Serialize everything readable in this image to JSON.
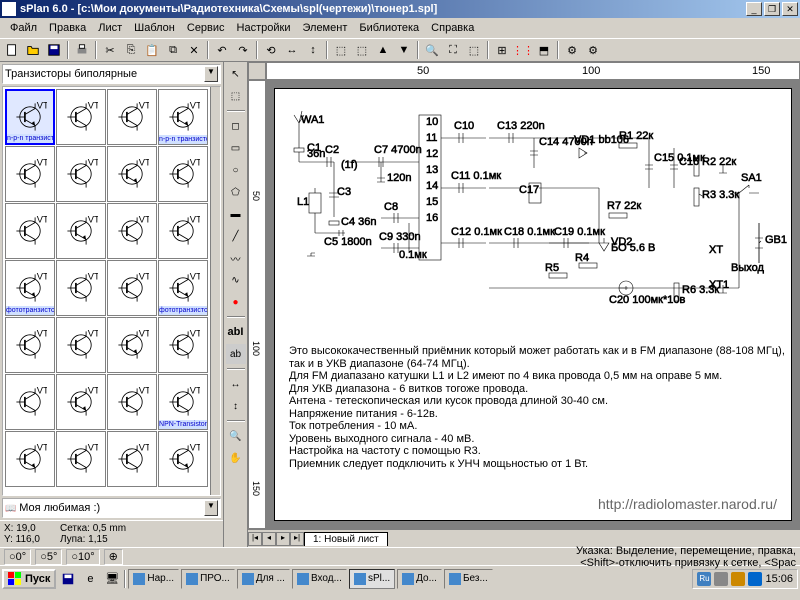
{
  "title": "sPlan 6.0 - [с:\\Мои документы\\Радиотехника\\Схемы\\spl(чертежи)\\тюнер1.spl]",
  "menu": [
    "Файл",
    "Правка",
    "Лист",
    "Шаблон",
    "Сервис",
    "Настройки",
    "Элемент",
    "Библиотека",
    "Справка"
  ],
  "leftCombo": "Транзисторы биполярные",
  "paletteLabels": [
    "n-p-n транзистор",
    "",
    "",
    "n-p-n транзистор",
    "",
    "",
    "",
    "",
    "",
    "",
    "",
    "",
    "фототранзистор",
    "",
    "",
    "фототранзистор",
    "",
    "",
    "",
    "",
    "",
    "",
    "",
    "NPN-Transistor"
  ],
  "bottomCombo": "Моя любимая :)",
  "statusLeft": {
    "x": "X: 19,0",
    "y": "Y: 116,0",
    "grid": "Сетка: 0,5 mm",
    "zoom": "Лупа: 1,15"
  },
  "rulerH": {
    "a": "50",
    "b": "100",
    "c": "150"
  },
  "rulerV": {
    "a": "50",
    "b": "100",
    "c": "150"
  },
  "sheetTab": "1: Новый лист",
  "schematic_labels": [
    "WA1",
    "C1",
    "36n",
    "L1",
    "C2",
    "C3",
    "C4",
    "36n",
    "C5",
    "1800n",
    "(1f)",
    "C7",
    "4700n",
    "120n",
    "C8",
    "C9",
    "330n",
    "0.1мк",
    "10",
    "11",
    "12",
    "13",
    "14",
    "15",
    "16",
    "C10",
    "C11",
    "0.1мк",
    "C12",
    "0.1мк",
    "C13",
    "C13 220n",
    "C14",
    "4700n",
    "C17",
    "0.1мк",
    "C18",
    "0.1мк",
    "C19",
    "0.1мк",
    "R4",
    "R5",
    "R7",
    "22к",
    "VD1",
    "bb106",
    "R1",
    "22к",
    "C15",
    "0.1мк",
    "C16",
    "R2",
    "22к",
    "R3 3.3к",
    "VD2",
    "БО 5.6 В",
    "C20",
    "100мк*10в",
    "R6",
    "3.3к",
    "XT",
    "XT1",
    "SA1",
    "Выход",
    "GB1"
  ],
  "description": [
    "Это высококачественный приёмник который может работать как и в FM диапазоне (88-108 МГц),",
    "так и в УКВ диапазоне (64-74 МГц).",
    "Для FM диапазано катушки L1 и L2 имеют по 4 вика провода 0,5 мм на оправе 5 мм.",
    "Для УКВ диапазона - 6 витков тогоже провода.",
    "Антена - тетескопическая или кусок провода длиной 30-40 см.",
    "Напряжение питания - 6-12в.",
    "Ток потребления - 10 мА.",
    "Уровень выходного сигнала - 40 мВ.",
    "Настройка на частоту с помощью R3.",
    "Приемник следует подключить к УНЧ мощьностью от 1 Вт."
  ],
  "watermark": "http://radiolomaster.narod.ru/",
  "angles": {
    "a": "0°",
    "b": "5°",
    "c": "10°"
  },
  "statusRight": "Указка: Выделение, перемещение, правка,",
  "statusRight2": "<Shift>-отключить привязку к сетке, <Spac",
  "taskbar": {
    "start": "Пуск",
    "items": [
      "Нар...",
      "ПРО...",
      "Для ...",
      "Вход...",
      "sPl...",
      "До...",
      "Без..."
    ],
    "tray": [
      "Ru",
      "",
      "",
      "",
      "15:06"
    ],
    "clock": "15:06"
  }
}
